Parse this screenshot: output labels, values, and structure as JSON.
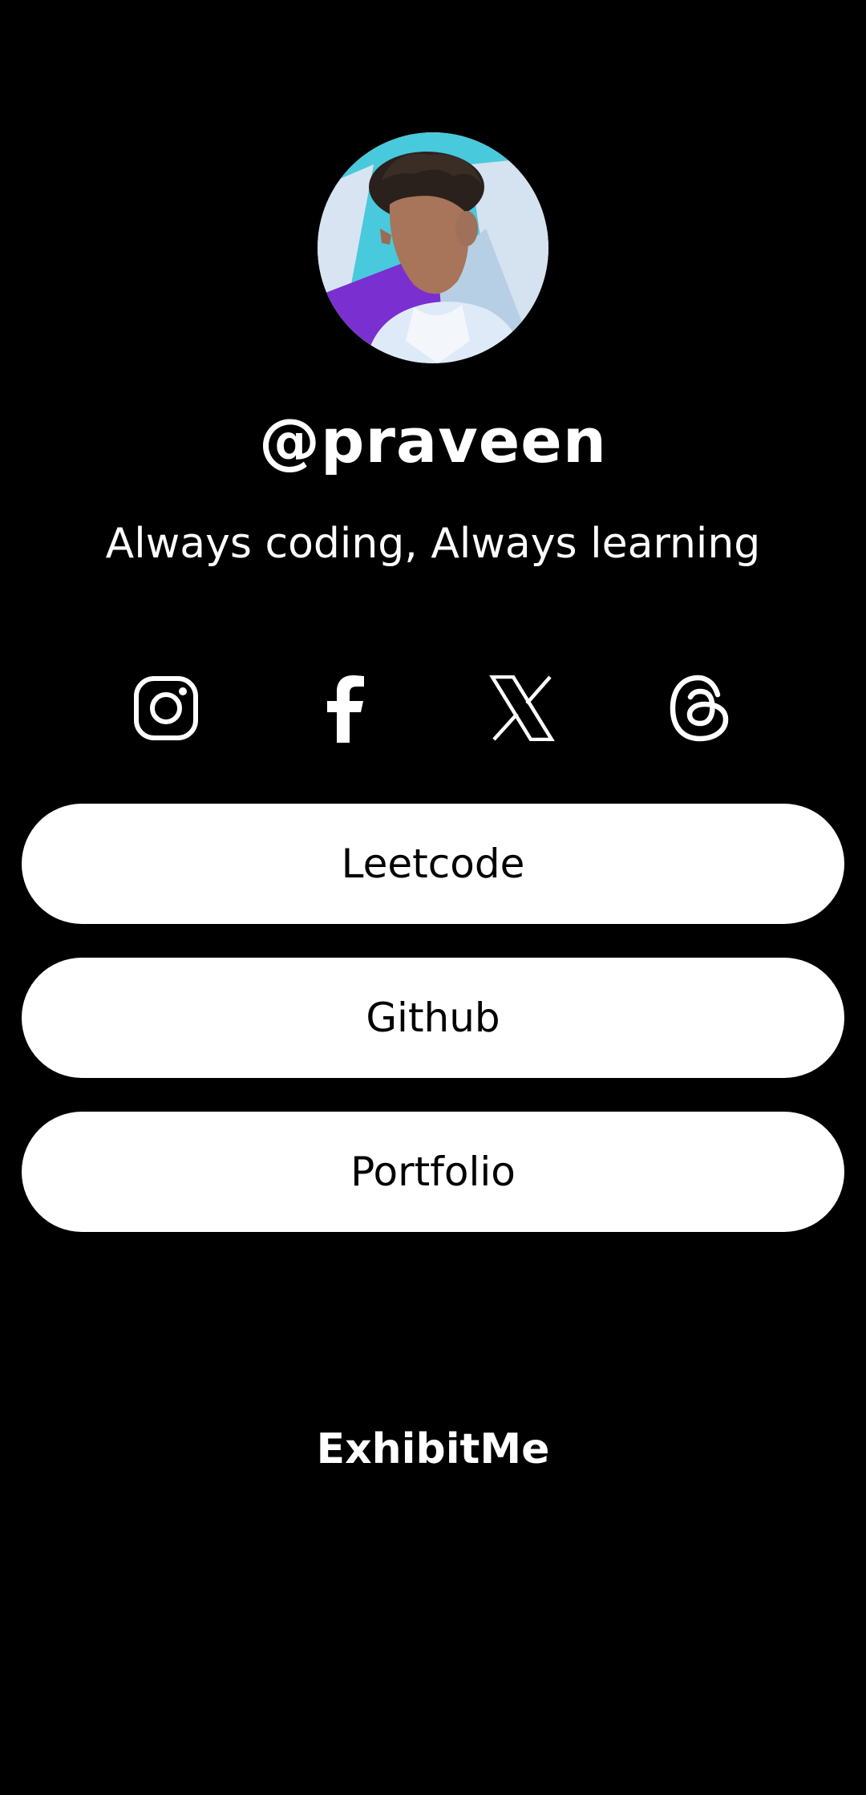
{
  "profile": {
    "username": "@praveen",
    "bio": "Always coding, Always learning",
    "avatar_icon": "profile-photo"
  },
  "socials": [
    {
      "name": "instagram-icon",
      "label": "Instagram"
    },
    {
      "name": "facebook-icon",
      "label": "Facebook"
    },
    {
      "name": "x-icon",
      "label": "X"
    },
    {
      "name": "threads-icon",
      "label": "Threads"
    }
  ],
  "links": [
    {
      "label": "Leetcode"
    },
    {
      "label": "Github"
    },
    {
      "label": "Portfolio"
    }
  ],
  "footer": {
    "brand": "ExhibitMe"
  },
  "colors": {
    "background": "#000000",
    "foreground": "#ffffff",
    "button_background": "#ffffff",
    "button_text": "#000000"
  }
}
